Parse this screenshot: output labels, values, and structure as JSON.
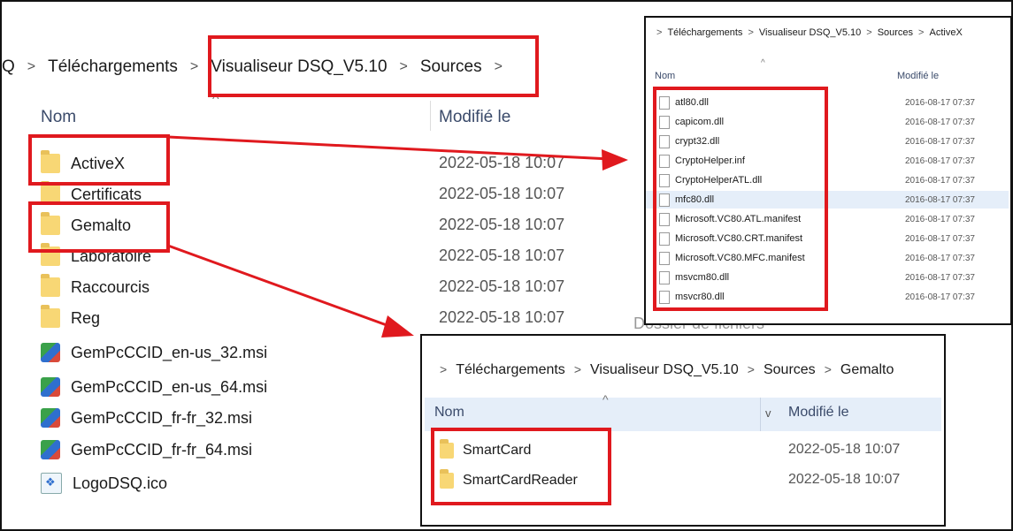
{
  "main": {
    "breadcrumb": [
      "Q",
      "Téléchargements",
      "Visualiseur DSQ_V5.10",
      "Sources",
      ""
    ],
    "sep": ">",
    "header_name": "Nom",
    "header_modified": "Modifié le",
    "sort_caret": "^",
    "rows": [
      {
        "name": "ActiveX",
        "type": "folder",
        "date": "2022-05-18 10:07"
      },
      {
        "name": "Certificats",
        "type": "folder",
        "date": "2022-05-18 10:07"
      },
      {
        "name": "Gemalto",
        "type": "folder",
        "date": "2022-05-18 10:07"
      },
      {
        "name": "Laboratoire",
        "type": "folder",
        "date": "2022-05-18 10:07"
      },
      {
        "name": "Raccourcis",
        "type": "folder",
        "date": "2022-05-18 10:07"
      },
      {
        "name": "Reg",
        "type": "folder",
        "date": "2022-05-18 10:07"
      },
      {
        "name": "GemPcCCID_en-us_32.msi",
        "type": "msi",
        "date": ""
      },
      {
        "name": "GemPcCCID_en-us_64.msi",
        "type": "msi",
        "date": ""
      },
      {
        "name": "GemPcCCID_fr-fr_32.msi",
        "type": "msi",
        "date": ""
      },
      {
        "name": "GemPcCCID_fr-fr_64.msi",
        "type": "msi",
        "date": ""
      },
      {
        "name": "LogoDSQ.ico",
        "type": "ico",
        "date": ""
      }
    ],
    "partial_text": "Dossier de fichiers"
  },
  "activex_window": {
    "breadcrumb": [
      "Téléchargements",
      "Visualiseur DSQ_V5.10",
      "Sources",
      "ActiveX"
    ],
    "header_name": "Nom",
    "header_modified": "Modifié le",
    "files": [
      {
        "name": "atl80.dll",
        "date": "2016-08-17 07:37"
      },
      {
        "name": "capicom.dll",
        "date": "2016-08-17 07:37"
      },
      {
        "name": "crypt32.dll",
        "date": "2016-08-17 07:37"
      },
      {
        "name": "CryptoHelper.inf",
        "date": "2016-08-17 07:37"
      },
      {
        "name": "CryptoHelperATL.dll",
        "date": "2016-08-17 07:37"
      },
      {
        "name": "mfc80.dll",
        "date": "2016-08-17 07:37",
        "selected": true
      },
      {
        "name": "Microsoft.VC80.ATL.manifest",
        "date": "2016-08-17 07:37"
      },
      {
        "name": "Microsoft.VC80.CRT.manifest",
        "date": "2016-08-17 07:37"
      },
      {
        "name": "Microsoft.VC80.MFC.manifest",
        "date": "2016-08-17 07:37"
      },
      {
        "name": "msvcm80.dll",
        "date": "2016-08-17 07:37"
      },
      {
        "name": "msvcr80.dll",
        "date": "2016-08-17 07:37"
      }
    ]
  },
  "gemalto_window": {
    "breadcrumb": [
      "Téléchargements",
      "Visualiseur DSQ_V5.10",
      "Sources",
      "Gemalto"
    ],
    "header_name": "Nom",
    "header_modified": "Modifié le",
    "chevron": "v",
    "rows": [
      {
        "name": "SmartCard",
        "date": "2022-05-18 10:07"
      },
      {
        "name": "SmartCardReader",
        "date": "2022-05-18 10:07"
      }
    ]
  },
  "colors": {
    "highlight": "#e0191e",
    "folder": "#f8d775",
    "selection": "#e5eef9"
  }
}
